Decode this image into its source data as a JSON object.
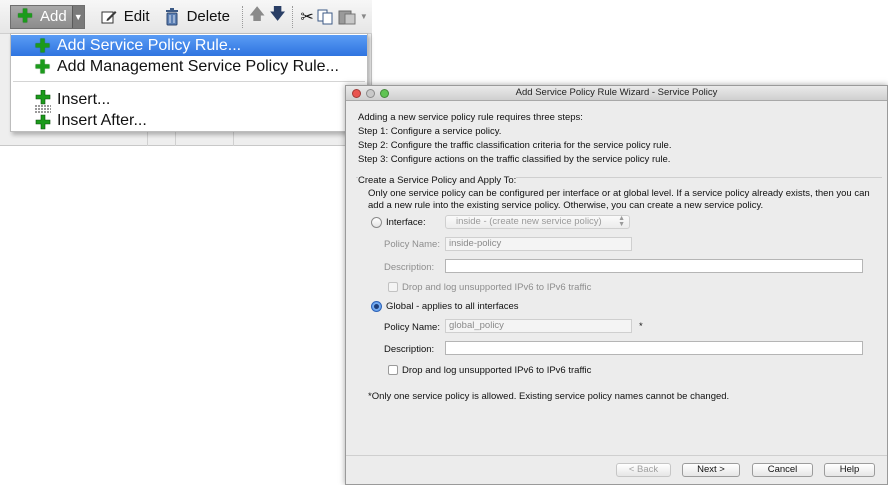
{
  "toolbar": {
    "add_label": "Add",
    "edit_label": "Edit",
    "delete_label": "Delete",
    "icons": [
      "plus-icon",
      "dropdown-arrow-icon",
      "edit-icon",
      "trash-icon",
      "arrow-up-icon",
      "arrow-down-icon",
      "cut-icon",
      "copy-icon",
      "paste-icon",
      "paste-dropdown-icon"
    ]
  },
  "menu": {
    "items": [
      {
        "label": "Add Service Policy Rule...",
        "icon": "plus-icon",
        "selected": true
      },
      {
        "label": "Add Management Service Policy Rule...",
        "icon": "plus-icon",
        "selected": false
      },
      {
        "label": "Insert...",
        "icon": "insert-icon",
        "selected": false
      },
      {
        "label": "Insert After...",
        "icon": "insert-after-icon",
        "selected": false
      }
    ]
  },
  "dialog": {
    "title": "Add Service Policy Rule Wizard - Service Policy",
    "intro": "Adding a new service policy rule requires three steps:",
    "steps": [
      "Step 1:  Configure a service policy.",
      "Step 2:  Configure the traffic classification criteria for the service policy rule.",
      "Step 3:  Configure actions on the traffic classified by the service policy rule."
    ],
    "group_title": "Create a Service Policy and Apply To:",
    "group_description": "Only one service policy can be configured per interface or at global level. If a service policy already exists, then you can add a new rule into the existing service policy. Otherwise, you can create a new service policy.",
    "interface_option": {
      "label": "Interface:",
      "selected_value": "inside - (create new service policy)",
      "policy_name_label": "Policy Name:",
      "policy_name_value": "inside-policy",
      "description_label": "Description:",
      "description_value": "",
      "ipv6_label": "Drop and log unsupported IPv6 to IPv6 traffic",
      "checked": false
    },
    "global_option": {
      "label": "Global - applies to all interfaces",
      "policy_name_label": "Policy Name:",
      "policy_name_value": "global_policy",
      "required_marker": "*",
      "description_label": "Description:",
      "description_value": "",
      "ipv6_label": "Drop and log unsupported IPv6 to IPv6 traffic",
      "checked": true
    },
    "footnote": "*Only one service policy is allowed. Existing service policy names cannot be changed.",
    "buttons": {
      "back": "< Back",
      "next": "Next >",
      "cancel": "Cancel",
      "help": "Help"
    }
  },
  "colors": {
    "menu_selection": "#3a7ee8",
    "plus_icon": "#1c9b1c",
    "close_light": "#e9544f",
    "zoom_light": "#60c453"
  }
}
